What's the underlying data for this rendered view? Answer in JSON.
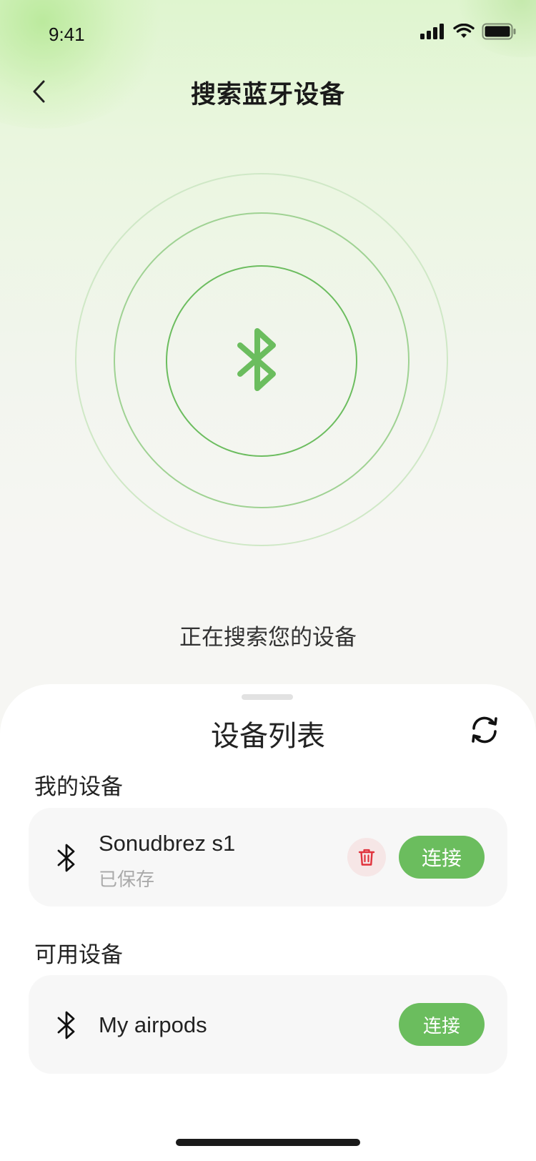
{
  "status_bar": {
    "time": "9:41"
  },
  "nav": {
    "title": "搜索蓝牙设备"
  },
  "scan": {
    "status_text": "正在搜索您的设备"
  },
  "sheet": {
    "title": "设备列表",
    "my_devices": {
      "label": "我的设备",
      "items": [
        {
          "name": "Sonudbrez s1",
          "status": "已保存",
          "connect_label": "连接"
        }
      ]
    },
    "available_devices": {
      "label": "可用设备",
      "items": [
        {
          "name": "My airpods",
          "connect_label": "连接"
        }
      ]
    }
  },
  "colors": {
    "accent": "#6bbd5e",
    "delete": "#e0323c",
    "delete_bg": "#f6e6e6"
  },
  "icons": [
    "back-arrow-icon",
    "bluetooth-icon",
    "refresh-icon",
    "trash-icon",
    "signal-icon",
    "wifi-icon",
    "battery-icon"
  ]
}
